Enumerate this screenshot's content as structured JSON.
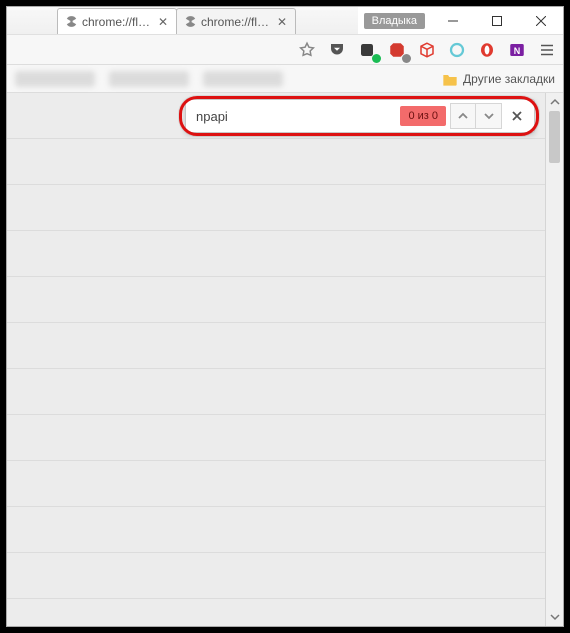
{
  "window": {
    "user_tag": "Владыка"
  },
  "tabs": [
    {
      "label": "chrome://fla…",
      "active": true
    },
    {
      "label": "chrome://fla…",
      "active": false
    }
  ],
  "bookmarks": {
    "other_folder": "Другие закладки"
  },
  "find": {
    "value": "npapi",
    "count_label": "0 из 0"
  }
}
